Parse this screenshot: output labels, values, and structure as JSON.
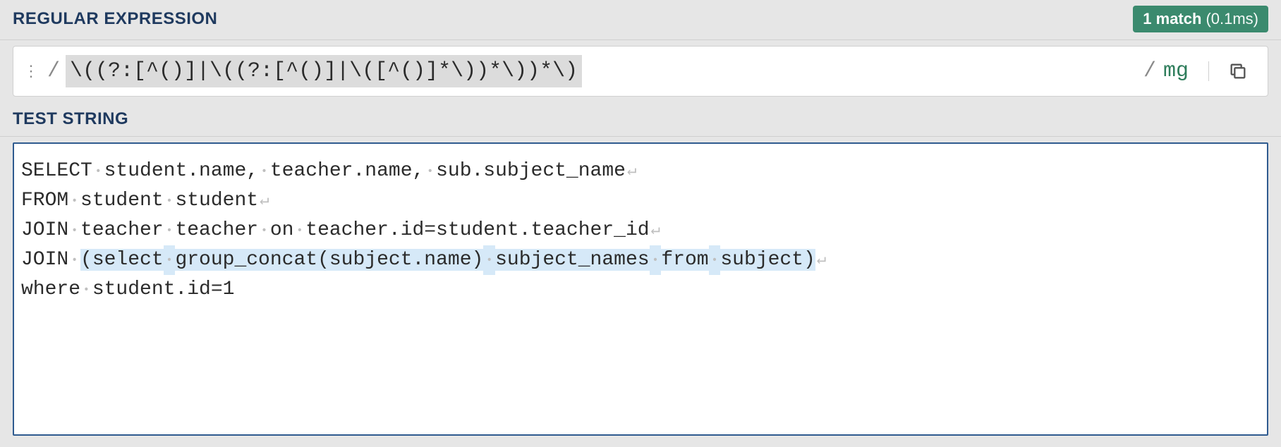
{
  "regex_section": {
    "label": "REGULAR EXPRESSION",
    "match_count_label": "1 match",
    "match_time_label": "(0.1ms)",
    "open_delim": "/",
    "close_delim": "/",
    "pattern": "\\((?:[^()]|\\((?:[^()]|\\([^()]*\\))*\\))*\\)",
    "flags": "mg",
    "copy_icon": "copy-icon"
  },
  "test_section": {
    "label": "TEST STRING",
    "lines": [
      {
        "tokens": [
          "SELECT",
          " ",
          "student.name,",
          " ",
          "teacher.name,",
          " ",
          "sub.subject_name"
        ],
        "nl": true
      },
      {
        "tokens": [
          "FROM",
          " ",
          "student",
          " ",
          "student"
        ],
        "nl": true
      },
      {
        "tokens": [
          "JOIN",
          " ",
          "teacher",
          " ",
          "teacher",
          " ",
          "on",
          " ",
          "teacher.id=student.teacher_id"
        ],
        "nl": true
      },
      {
        "tokens": [
          "JOIN",
          " ",
          {
            "hl": true,
            "t": "(select"
          },
          " ",
          {
            "hl": true,
            "t": "group_concat(subject.name)"
          },
          " ",
          {
            "hl": true,
            "t": "subject_names"
          },
          " ",
          {
            "hl": true,
            "t": "from"
          },
          " ",
          {
            "hl": true,
            "t": "subject)"
          }
        ],
        "nl": true,
        "hl_spaces_from": 2
      },
      {
        "tokens": [
          "where",
          " ",
          "student.id=1"
        ],
        "nl": false
      }
    ]
  }
}
